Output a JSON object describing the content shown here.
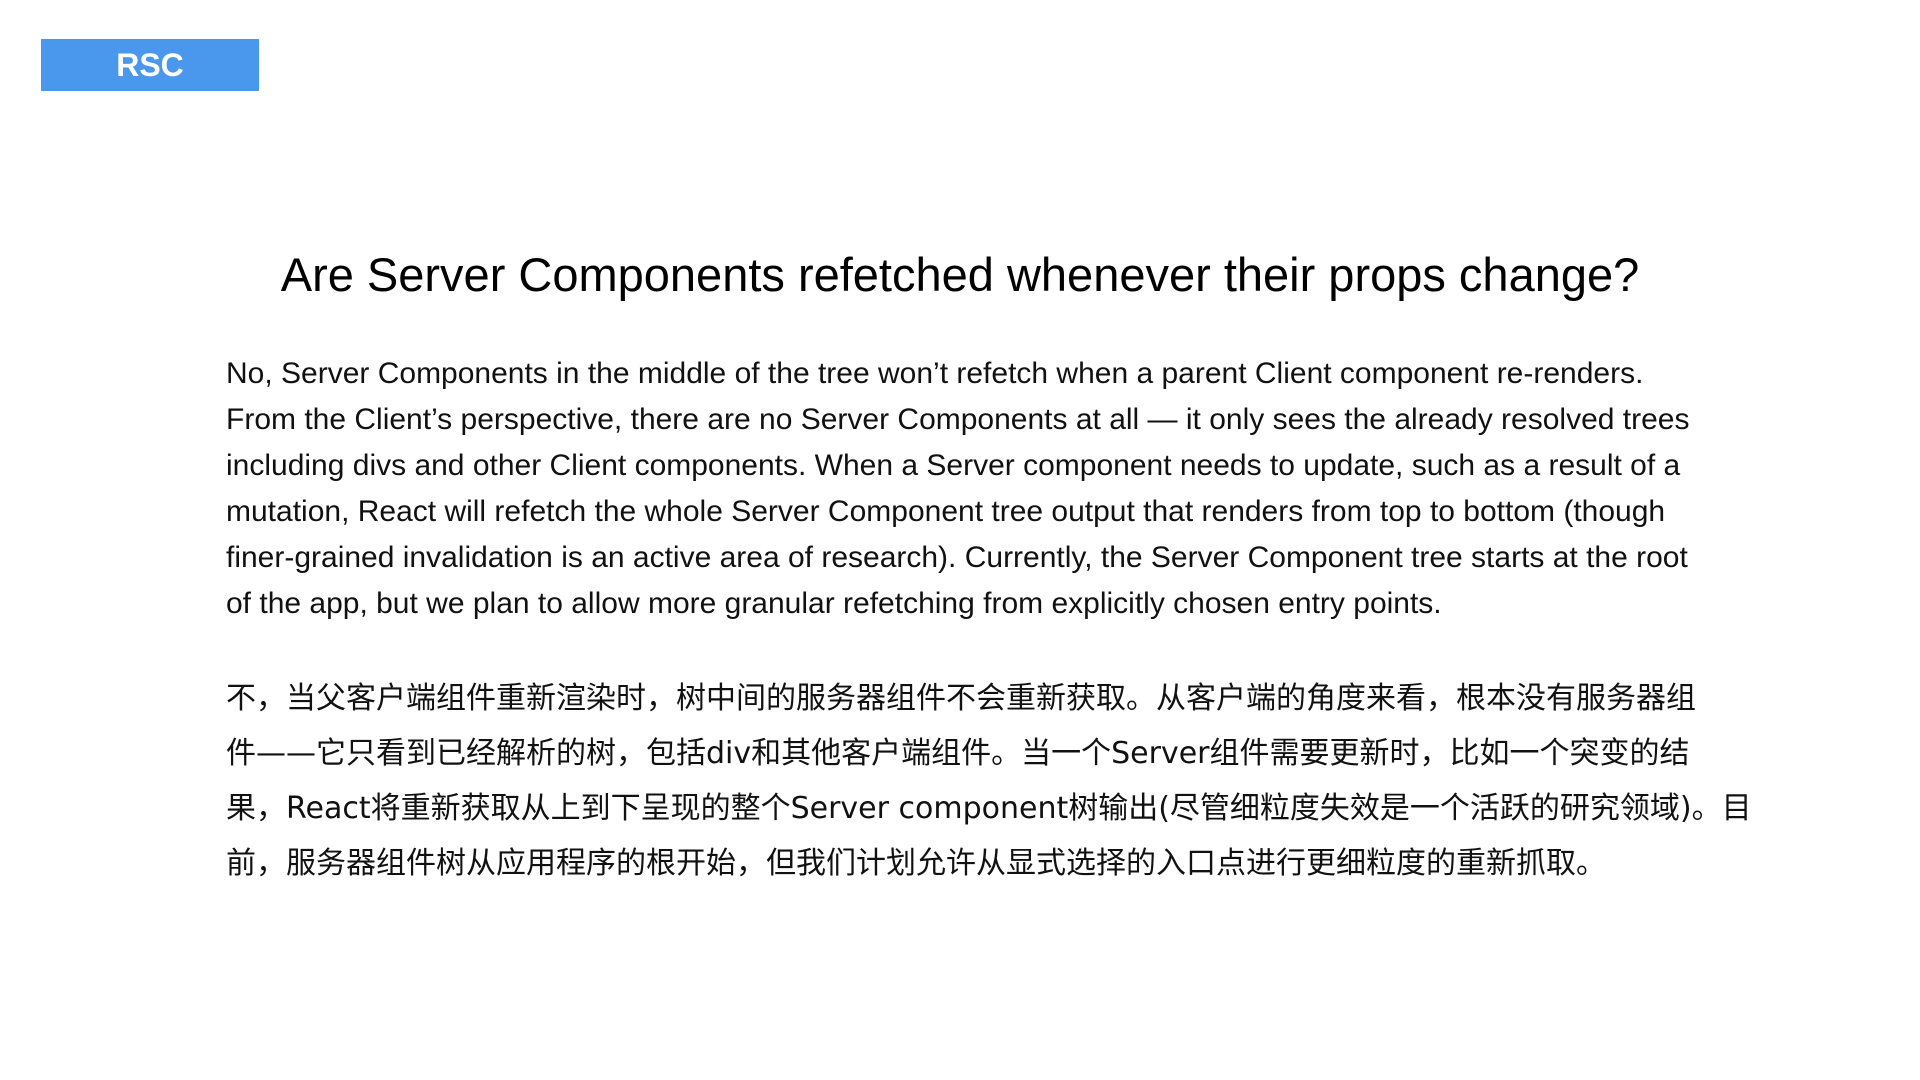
{
  "tag": {
    "label": "RSC",
    "color": "#4a97ee"
  },
  "title": "Are Server Components refetched whenever their props change?",
  "english_lines": [
    "No, Server Components in the middle of the tree won’t refetch when a parent Client component re-renders.",
    "From the Client’s perspective, there are no Server Components at all — it only sees the already resolved trees",
    "including divs and other Client components. When a Server component needs to update, such as a result of a",
    "mutation, React will refetch the whole Server Component tree output that renders from top to bottom (though",
    "finer-grained invalidation is an active area of research). Currently, the Server Component tree starts at the root",
    "of the app, but we plan to allow more granular refetching from explicitly chosen entry points."
  ],
  "chinese_lines": [
    "不，当父客户端组件重新渲染时，树中间的服务器组件不会重新获取。从客户端的角度来看，根本没有服务器组",
    "件——它只看到已经解析的树，包括div和其他客户端组件。当一个Server组件需要更新时，比如一个突变的结",
    "果，React将重新获取从上到下呈现的整个Server component树输出(尽管细粒度失效是一个活跃的研究领域)。目",
    "前，服务器组件树从应用程序的根开始，但我们计划允许从显式选择的入口点进行更细粒度的重新抓取。"
  ]
}
